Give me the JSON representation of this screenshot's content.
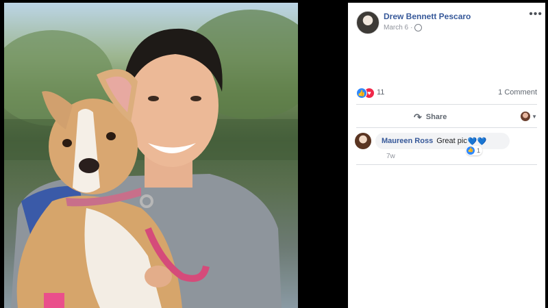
{
  "post": {
    "author": "Drew Bennett Pescaro",
    "date": "March 6",
    "separator": "·",
    "more_icon": "•••",
    "reaction_count": "11",
    "comment_count_label": "1 Comment",
    "share_label": "Share"
  },
  "icons": {
    "like": "👍",
    "love": "♥",
    "share": "↷",
    "caret": "▼"
  },
  "comment": {
    "author": "Maureen Ross",
    "text": "Great pic",
    "emoji": "💙💙",
    "reaction_count": "1",
    "time": "7w"
  },
  "colors": {
    "link": "#365899",
    "like_blue": "#2d88ff",
    "love_red": "#f0284a",
    "muted": "#90949c"
  }
}
